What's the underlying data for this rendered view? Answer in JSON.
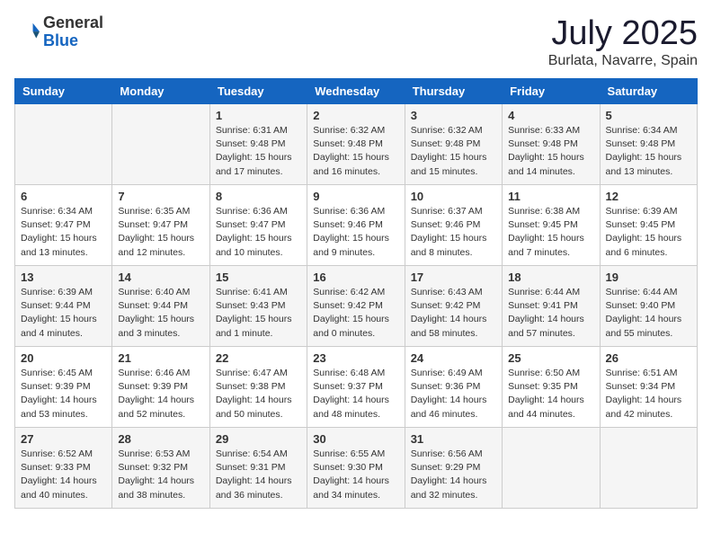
{
  "header": {
    "logo_general": "General",
    "logo_blue": "Blue",
    "month": "July 2025",
    "location": "Burlata, Navarre, Spain"
  },
  "weekdays": [
    "Sunday",
    "Monday",
    "Tuesday",
    "Wednesday",
    "Thursday",
    "Friday",
    "Saturday"
  ],
  "weeks": [
    [
      {
        "day": "",
        "info": ""
      },
      {
        "day": "",
        "info": ""
      },
      {
        "day": "1",
        "info": "Sunrise: 6:31 AM\nSunset: 9:48 PM\nDaylight: 15 hours\nand 17 minutes."
      },
      {
        "day": "2",
        "info": "Sunrise: 6:32 AM\nSunset: 9:48 PM\nDaylight: 15 hours\nand 16 minutes."
      },
      {
        "day": "3",
        "info": "Sunrise: 6:32 AM\nSunset: 9:48 PM\nDaylight: 15 hours\nand 15 minutes."
      },
      {
        "day": "4",
        "info": "Sunrise: 6:33 AM\nSunset: 9:48 PM\nDaylight: 15 hours\nand 14 minutes."
      },
      {
        "day": "5",
        "info": "Sunrise: 6:34 AM\nSunset: 9:48 PM\nDaylight: 15 hours\nand 13 minutes."
      }
    ],
    [
      {
        "day": "6",
        "info": "Sunrise: 6:34 AM\nSunset: 9:47 PM\nDaylight: 15 hours\nand 13 minutes."
      },
      {
        "day": "7",
        "info": "Sunrise: 6:35 AM\nSunset: 9:47 PM\nDaylight: 15 hours\nand 12 minutes."
      },
      {
        "day": "8",
        "info": "Sunrise: 6:36 AM\nSunset: 9:47 PM\nDaylight: 15 hours\nand 10 minutes."
      },
      {
        "day": "9",
        "info": "Sunrise: 6:36 AM\nSunset: 9:46 PM\nDaylight: 15 hours\nand 9 minutes."
      },
      {
        "day": "10",
        "info": "Sunrise: 6:37 AM\nSunset: 9:46 PM\nDaylight: 15 hours\nand 8 minutes."
      },
      {
        "day": "11",
        "info": "Sunrise: 6:38 AM\nSunset: 9:45 PM\nDaylight: 15 hours\nand 7 minutes."
      },
      {
        "day": "12",
        "info": "Sunrise: 6:39 AM\nSunset: 9:45 PM\nDaylight: 15 hours\nand 6 minutes."
      }
    ],
    [
      {
        "day": "13",
        "info": "Sunrise: 6:39 AM\nSunset: 9:44 PM\nDaylight: 15 hours\nand 4 minutes."
      },
      {
        "day": "14",
        "info": "Sunrise: 6:40 AM\nSunset: 9:44 PM\nDaylight: 15 hours\nand 3 minutes."
      },
      {
        "day": "15",
        "info": "Sunrise: 6:41 AM\nSunset: 9:43 PM\nDaylight: 15 hours\nand 1 minute."
      },
      {
        "day": "16",
        "info": "Sunrise: 6:42 AM\nSunset: 9:42 PM\nDaylight: 15 hours\nand 0 minutes."
      },
      {
        "day": "17",
        "info": "Sunrise: 6:43 AM\nSunset: 9:42 PM\nDaylight: 14 hours\nand 58 minutes."
      },
      {
        "day": "18",
        "info": "Sunrise: 6:44 AM\nSunset: 9:41 PM\nDaylight: 14 hours\nand 57 minutes."
      },
      {
        "day": "19",
        "info": "Sunrise: 6:44 AM\nSunset: 9:40 PM\nDaylight: 14 hours\nand 55 minutes."
      }
    ],
    [
      {
        "day": "20",
        "info": "Sunrise: 6:45 AM\nSunset: 9:39 PM\nDaylight: 14 hours\nand 53 minutes."
      },
      {
        "day": "21",
        "info": "Sunrise: 6:46 AM\nSunset: 9:39 PM\nDaylight: 14 hours\nand 52 minutes."
      },
      {
        "day": "22",
        "info": "Sunrise: 6:47 AM\nSunset: 9:38 PM\nDaylight: 14 hours\nand 50 minutes."
      },
      {
        "day": "23",
        "info": "Sunrise: 6:48 AM\nSunset: 9:37 PM\nDaylight: 14 hours\nand 48 minutes."
      },
      {
        "day": "24",
        "info": "Sunrise: 6:49 AM\nSunset: 9:36 PM\nDaylight: 14 hours\nand 46 minutes."
      },
      {
        "day": "25",
        "info": "Sunrise: 6:50 AM\nSunset: 9:35 PM\nDaylight: 14 hours\nand 44 minutes."
      },
      {
        "day": "26",
        "info": "Sunrise: 6:51 AM\nSunset: 9:34 PM\nDaylight: 14 hours\nand 42 minutes."
      }
    ],
    [
      {
        "day": "27",
        "info": "Sunrise: 6:52 AM\nSunset: 9:33 PM\nDaylight: 14 hours\nand 40 minutes."
      },
      {
        "day": "28",
        "info": "Sunrise: 6:53 AM\nSunset: 9:32 PM\nDaylight: 14 hours\nand 38 minutes."
      },
      {
        "day": "29",
        "info": "Sunrise: 6:54 AM\nSunset: 9:31 PM\nDaylight: 14 hours\nand 36 minutes."
      },
      {
        "day": "30",
        "info": "Sunrise: 6:55 AM\nSunset: 9:30 PM\nDaylight: 14 hours\nand 34 minutes."
      },
      {
        "day": "31",
        "info": "Sunrise: 6:56 AM\nSunset: 9:29 PM\nDaylight: 14 hours\nand 32 minutes."
      },
      {
        "day": "",
        "info": ""
      },
      {
        "day": "",
        "info": ""
      }
    ]
  ]
}
